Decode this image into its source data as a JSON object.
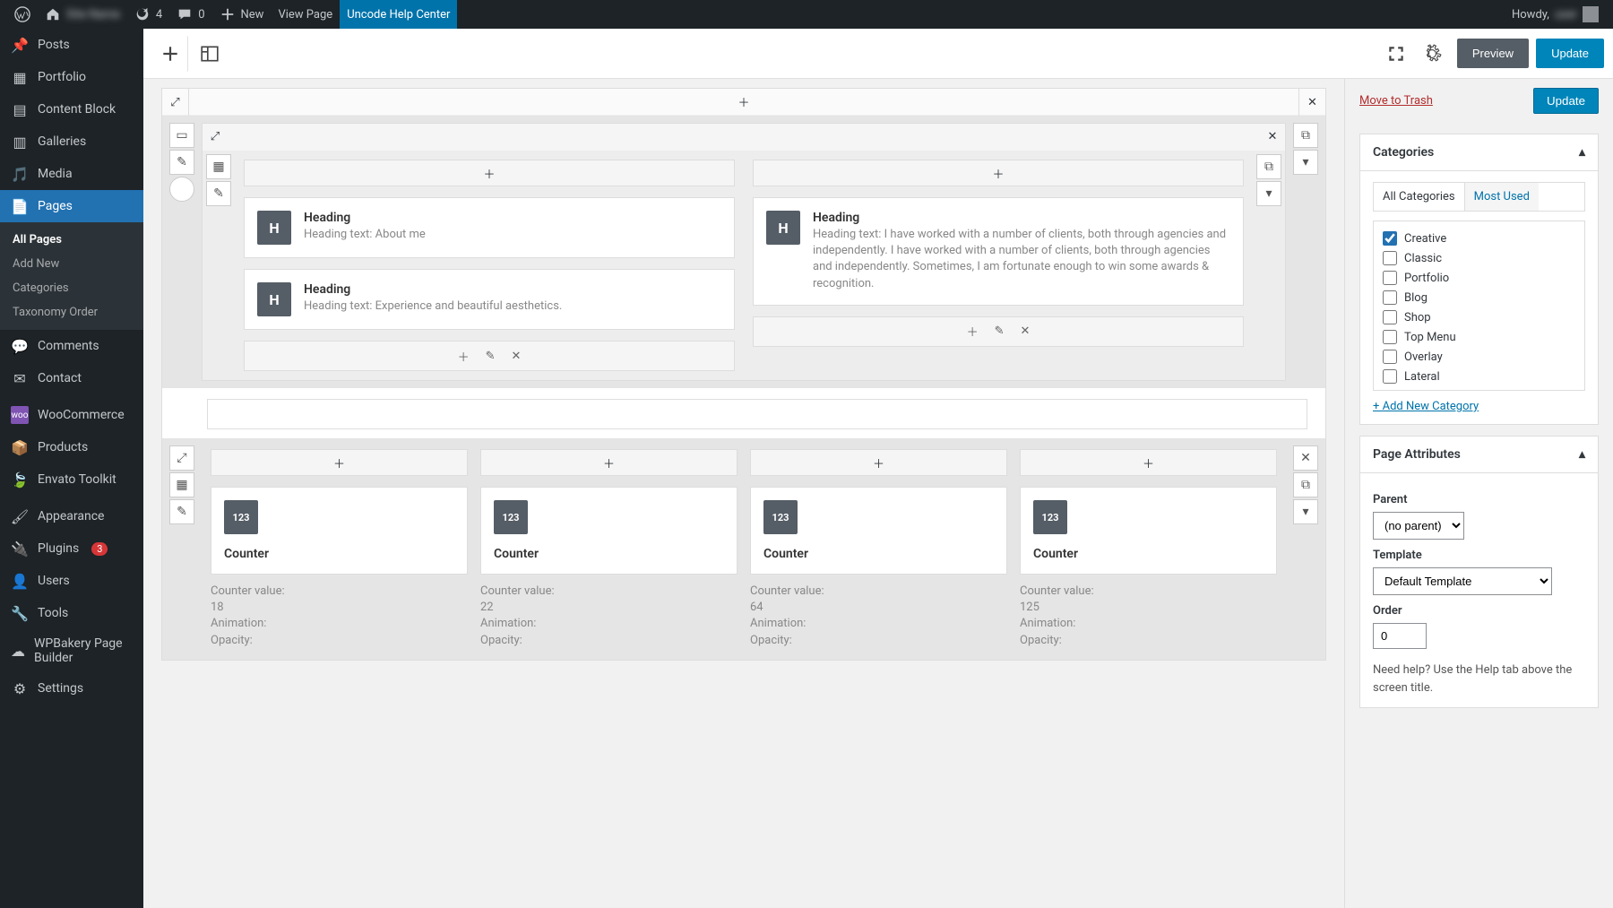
{
  "adminbar": {
    "site_name": "Site Name",
    "updates": "4",
    "comments": "0",
    "new": "New",
    "view_page": "View Page",
    "help_center": "Uncode Help Center",
    "howdy": "Howdy,",
    "user": "user"
  },
  "sidebar": {
    "items": [
      {
        "icon": "pin",
        "label": "Posts"
      },
      {
        "icon": "grid",
        "label": "Portfolio"
      },
      {
        "icon": "block",
        "label": "Content Block"
      },
      {
        "icon": "gallery",
        "label": "Galleries"
      },
      {
        "icon": "media",
        "label": "Media"
      },
      {
        "icon": "page",
        "label": "Pages",
        "current": true
      },
      {
        "icon": "comment",
        "label": "Comments"
      },
      {
        "icon": "mail",
        "label": "Contact"
      },
      {
        "icon": "woo",
        "label": "WooCommerce"
      },
      {
        "icon": "product",
        "label": "Products"
      },
      {
        "icon": "envato",
        "label": "Envato Toolkit"
      },
      {
        "icon": "brush",
        "label": "Appearance"
      },
      {
        "icon": "plug",
        "label": "Plugins",
        "badge": "3"
      },
      {
        "icon": "user",
        "label": "Users"
      },
      {
        "icon": "tool",
        "label": "Tools"
      },
      {
        "icon": "wpb",
        "label": "WPBakery Page Builder"
      },
      {
        "icon": "gear",
        "label": "Settings"
      }
    ],
    "submenu": {
      "items": [
        "All Pages",
        "Add New",
        "Categories",
        "Taxonomy Order"
      ]
    }
  },
  "topbar": {
    "preview": "Preview",
    "update": "Update"
  },
  "builder": {
    "heading_label": "Heading",
    "heading_text_label": "Heading text:",
    "h1_text": "About me",
    "h2_text": "Experience and beautiful aesthetics.",
    "h3_text": "I have worked with a number of clients, both through agencies and independently. I have worked with a number of clients, both through agencies and independently. Sometimes, I am fortunate enough to win some awards & recognition.",
    "counter_label": "Counter",
    "counter_value_label": "Counter value:",
    "animation_label": "Animation:",
    "opacity_label": "Opacity:",
    "counters": [
      {
        "value": "18"
      },
      {
        "value": "22"
      },
      {
        "value": "64"
      },
      {
        "value": "125"
      }
    ]
  },
  "rside": {
    "move_trash": "Move to Trash",
    "update": "Update",
    "categories": {
      "title": "Categories",
      "tab_all": "All Categories",
      "tab_most": "Most Used",
      "items": [
        {
          "label": "Creative",
          "checked": true
        },
        {
          "label": "Classic"
        },
        {
          "label": "Portfolio"
        },
        {
          "label": "Blog"
        },
        {
          "label": "Shop"
        },
        {
          "label": "Top Menu"
        },
        {
          "label": "Overlay"
        },
        {
          "label": "Lateral"
        }
      ],
      "add_new": "+ Add New Category"
    },
    "attrs": {
      "title": "Page Attributes",
      "parent_label": "Parent",
      "parent_value": "(no parent)",
      "template_label": "Template",
      "template_value": "Default Template",
      "order_label": "Order",
      "order_value": "0",
      "help": "Need help? Use the Help tab above the screen title."
    }
  }
}
